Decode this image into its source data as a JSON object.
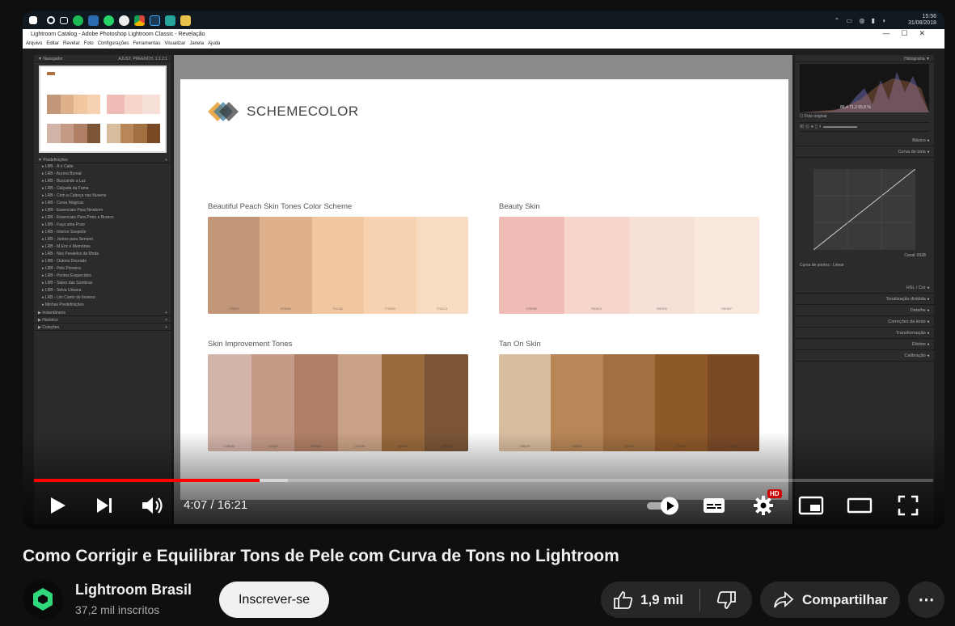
{
  "screen": {
    "taskbar": {
      "time": "15:56",
      "date": "31/08/2018"
    },
    "app_title": "Lightroom Catalog - Adobe Photoshop Lightroom Classic - Revelação",
    "menu": [
      "Arquivo",
      "Editar",
      "Revelar",
      "Foto",
      "Configurações",
      "Ferramentas",
      "Visualizar",
      "Janela",
      "Ajuda"
    ],
    "left_panel": {
      "navigator_label": "Navegador",
      "navigator_modes": "AJUST.   PREENCH.   1:1   2:1",
      "presets_label": "Predefinições",
      "presets": [
        "LRB - À o Calor",
        "LRB - Aurora Boreal",
        "LRB - Buscando a Luz",
        "LRB - Calçada da Fama",
        "LRB - Com a Cabeça nas Nuvens",
        "LRB - Cores Mágicas",
        "LRB - Essenciais Para Newborn",
        "LRB - Essenciais Para Preto e Branco",
        "LRB - Faça uma Pose",
        "LRB - Interior Suspeito",
        "LRB - Juntos para Sempre",
        "LRB - M Enc e Memórias",
        "LRB - Nos Paralelos da Moda",
        "LRB - Outono Dourado",
        "LRB - Pele Pioneira",
        "LRB - Pontos Esquecidos",
        "LRB - Sabor das Sombras",
        "LRB - Selva Urbana",
        "LRB - Um Canto do Inverno",
        "Minhas Predefinições"
      ],
      "snapshots_label": "Instantâneos",
      "history_label": "Histórico",
      "collections_label": "Coleções"
    },
    "slide": {
      "brand": "SCHEMECOLOR",
      "schemes": [
        {
          "title": "Beautiful Peach Skin Tones Color Scheme",
          "colors": [
            "#c29678",
            "#deb08c",
            "#f1c7a2",
            "#f7d2b0",
            "#f7dcc1"
          ],
          "codes": [
            "C29678",
            "DEB08C",
            "F1C7A2",
            "F7D2B0",
            "F7DCC1"
          ]
        },
        {
          "title": "Beauty Skin",
          "colors": [
            "#efbdb5",
            "#f6d6ca",
            "#f6e0d8",
            "#fae8df"
          ],
          "codes": [
            "EFBDB5",
            "F6D6CA",
            "F6E0D8",
            "FAE8DF"
          ]
        },
        {
          "title": "Skin Improvement Tones",
          "colors": [
            "#d3b4a9",
            "#c59a87",
            "#b08066",
            "#caa285",
            "#9a6b3d",
            "#7b5536"
          ],
          "codes": [
            "D3B4A9",
            "C59A87",
            "B08066",
            "CAA285",
            "9A6B3D",
            "7B5536"
          ]
        },
        {
          "title": "Tan On Skin",
          "colors": [
            "#d8bd9f",
            "#b88657",
            "#a26f40",
            "#8e5929",
            "#7a4a27"
          ],
          "codes": [
            "D8BD9F",
            "B88657",
            "A26F40",
            "8E5929",
            "7A4A27"
          ]
        }
      ]
    },
    "right_panel": {
      "histogram_label": "Histograma",
      "hist_values": "86,4   71,2   65,8 %",
      "original_photo": "Foto original",
      "sections": [
        "Básico",
        "Curva de tons",
        "HSL / Cor",
        "Tonalização dividida",
        "Detalhe",
        "Correções da lente",
        "Transformação",
        "Efeitos",
        "Calibração"
      ],
      "channel_label": "Canal: RGB",
      "tone_curve_label": "Curva de pontos : Linear"
    }
  },
  "player": {
    "time": "4:07 / 16:21",
    "progress_fraction": 0.251,
    "buffered_fraction": 0.282,
    "hd_badge": "HD"
  },
  "video": {
    "title": "Como Corrigir e Equilibrar Tons de Pele com Curva de Tons no Lightroom",
    "channel": "Lightroom Brasil",
    "subscribers": "37,2 mil inscritos",
    "subscribe_label": "Inscrever-se",
    "likes": "1,9 mil",
    "share_label": "Compartilhar"
  }
}
